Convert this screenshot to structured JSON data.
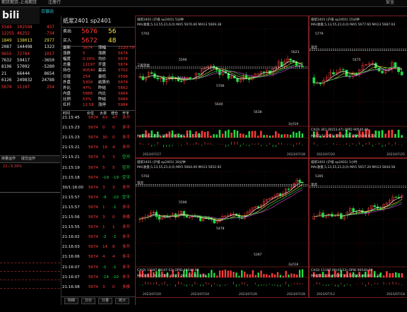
{
  "app": {
    "title": "期货期货-上海期货",
    "menu": [
      "期货期货-上海期货",
      "注册行"
    ],
    "tabs": [
      "日银运",
      "交易"
    ],
    "right_label": "安全"
  },
  "left_list": {
    "rows": [
      {
        "c1": "5544",
        "c2": "102594",
        "c3": "437",
        "color": "r"
      },
      {
        "c1": "12255",
        "c2": "46252",
        "c3": "-734",
        "color": "r"
      },
      {
        "c1": "1849",
        "c2": "138013",
        "c3": "2977",
        "color": "y"
      },
      {
        "c1": "2087",
        "c2": "144498",
        "c3": "1323",
        "color": "w"
      },
      {
        "c1": "9655",
        "c2": "72784",
        "c3": "1017",
        "color": "r"
      },
      {
        "c1": "7632",
        "c2": "59417",
        "c3": "-3650",
        "color": "w"
      },
      {
        "c1": "8196",
        "c2": "57092",
        "c3": "-5280",
        "color": "w"
      },
      {
        "c1": "21",
        "c2": "66444",
        "c3": "8654",
        "color": "w"
      },
      {
        "c1": "6126",
        "c2": "249832",
        "c3": "24788",
        "color": "w"
      },
      {
        "c1": "5674",
        "c2": "11197",
        "c3": "254",
        "color": "r"
      }
    ],
    "tabs": [
      "持量运作",
      "成交运作"
    ],
    "tab_info": "22 / 6.39%"
  },
  "quote": {
    "title": "纸浆2401 sp2401",
    "sell_label": "卖出",
    "sell_price": "5676",
    "sell_vol": "56",
    "buy_label": "买入",
    "buy_price": "5672",
    "buy_vol": "48",
    "stats": [
      [
        "最新",
        "5674",
        "涨幅",
        "2220.79%"
      ],
      [
        "涨跌",
        "5",
        "涨跌",
        "5674"
      ],
      [
        "幅度",
        "0.39%",
        "均价",
        "5674"
      ],
      [
        "总量",
        "11197",
        "开盘",
        "5674"
      ],
      [
        "持仓",
        "90540",
        "最高",
        "5702"
      ],
      [
        "日增",
        "254",
        "最低",
        "5596"
      ],
      [
        "外盘",
        "5309",
        "结算价",
        "5674"
      ],
      [
        "外比",
        "47%",
        "昨结",
        "5662"
      ],
      [
        "内盘",
        "5888",
        "内比",
        "5664"
      ],
      [
        "比例",
        "53%",
        "昨结",
        "5664"
      ],
      [
        "杠杆",
        "12.58",
        "涨停",
        "5984"
      ]
    ],
    "ticks_header": [
      "时间",
      "价位",
      "大单",
      "增仓",
      "开平"
    ],
    "ticks": [
      [
        "21:15:45",
        "5674",
        "63",
        "47",
        "多开"
      ],
      [
        "21:15:23",
        "5674",
        "0",
        "0",
        "多平"
      ],
      [
        "21:15:23",
        "5674",
        "30",
        "0",
        "多平"
      ],
      [
        "21:15:21",
        "5674",
        "16",
        "4",
        "多开"
      ],
      [
        "21:15:21",
        "5674",
        "5",
        "3",
        "空开"
      ],
      [
        "21:15:19",
        "5674",
        "5",
        "5",
        "空开"
      ],
      [
        "21:15:18",
        "5674",
        "-19",
        "-19",
        "空平"
      ],
      [
        "30/1:16:00",
        "5674",
        "3",
        "3",
        "多开"
      ],
      [
        "21:15:57",
        "5674",
        "-9",
        "-10",
        "空平"
      ],
      [
        "21:15:57",
        "5674",
        "1",
        "-1",
        "多平"
      ],
      [
        "21:15:56",
        "5674",
        "3",
        "0",
        "多换"
      ],
      [
        "21:15:55",
        "5674",
        "1",
        "1",
        "多开"
      ],
      [
        "21:16:02",
        "5674",
        "-2",
        "-1",
        "多平"
      ],
      [
        "21:16:03",
        "5674",
        "14",
        "8",
        "多开"
      ],
      [
        "21:16:06",
        "5674",
        "4",
        "4",
        "多平"
      ],
      [
        "21:16:07",
        "5674",
        "-1",
        "-1",
        "多平"
      ],
      [
        "21:16:07",
        "5674",
        "-14",
        "-10",
        "多平"
      ],
      [
        "21:16:08",
        "5674",
        "3",
        "0",
        "多换"
      ]
    ],
    "bottom_tabs": [
      "明细",
      "分价",
      "分量",
      "统计"
    ]
  },
  "charts": [
    {
      "title": "纸浆2401 (沪纸 sp2401) 5分钟",
      "ma_line": "MA(收盘,5,13,55,21,0,0)  MA5 5676.60  MA13 5669.38",
      "price_labels": {
        "hi": "5702",
        "lo": "5596",
        "p1": "5706",
        "p2": "5638",
        "p3": "5623",
        "p4": "5612",
        "p5": "5640"
      },
      "dashed_label": "三股资金",
      "macd": "MACD(12,26,9)  DIFF 7.95  DEA 7.17  1.55",
      "dates": [
        "2023/07/27",
        "2023/07/28"
      ],
      "tag": "3分519"
    },
    {
      "title": "纸浆2401 (沪纸 sp2401) 15分钟",
      "ma_line": "MA(收盘,5,13,55,21,0,0)  MA5 5677.60  MA13 5687.04",
      "price_labels": {
        "p1": "5779",
        "p2": "5475"
      },
      "dashed_label": "现货",
      "cx": "CX(0)  361.00(53.47)  OPID 90540.00",
      "macd": "MACD(12,26,9)  DIFF 7.15  DEA 4.08  6.13",
      "dates": [
        "2023/07/20",
        "2023/07/25"
      ]
    },
    {
      "title": "纸浆2401 (沪纸 sp2401) 30分钟",
      "ma_line": "MA(收盘,5,13,55,21,0,0)  MA5 5664.00  MA13 5652.92",
      "price_labels": {
        "p1": "5702",
        "p2": "5596",
        "p3": "5478",
        "p4": "5397"
      },
      "dashed_label": "现货",
      "cx": "CX(0)  11197.00(47.53)  OPID 90540.00",
      "macd": "MACD(12,26,9)  DIFF 19.17  DEA 21.71  -5.08",
      "dates": [
        "2023/07/20",
        "2023/07/24",
        "2023/07/26",
        "2023/07/28"
      ],
      "tag": "3分518"
    },
    {
      "title": "纸浆2401 (沪纸 sp2401) 1小时",
      "ma_line": "MA(收盘,5,13,55,21,0,0)  MA5 5657.20  MA13 5644.58",
      "price_labels": {
        "p1": "5395"
      },
      "dashed_label": "现货",
      "cx": "CX(0)  11197.00(47.53)  OPID 90540.00",
      "macd": "MACD(12,26,9)  DIFF 44.54  DEA 46.88  -3.39",
      "dates": [
        "2023/07/12",
        "2023/07/18"
      ]
    }
  ],
  "colors": {
    "up": "#ff3b3b",
    "down": "#22dd44",
    "ma5": "#ffffff",
    "ma13": "#f0e040",
    "ma55": "#e040e0",
    "ma21": "#22dd44"
  }
}
